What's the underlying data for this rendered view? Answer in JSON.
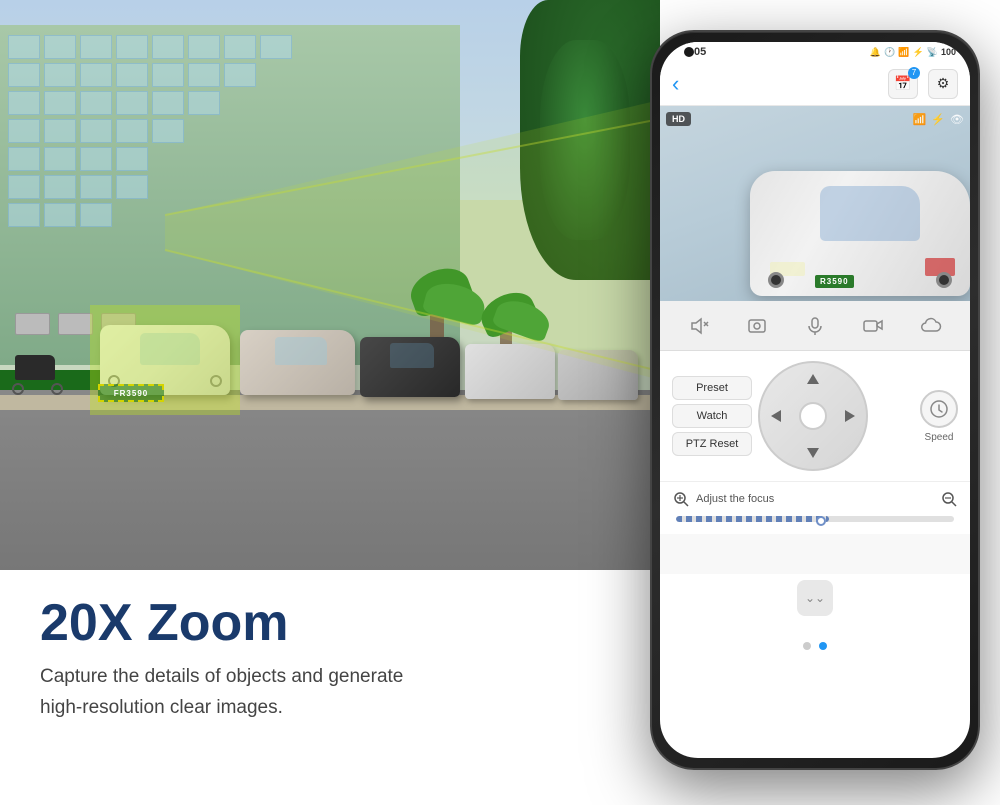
{
  "scene": {
    "background_color": "#c8d8c0"
  },
  "bottom_section": {
    "title": "20X Zoom",
    "description_line1": "Capture the details of objects and generate",
    "description_line2": "high-resolution clear images."
  },
  "phone": {
    "status_bar": {
      "time": "05",
      "icons": [
        "📶",
        "🔋",
        "📡"
      ]
    },
    "header": {
      "back_icon": "‹",
      "calendar_icon": "📅",
      "settings_icon": "⚙",
      "calendar_badge": "7"
    },
    "video": {
      "hd_label": "HD",
      "license_plate": "R3590"
    },
    "controls": {
      "icons": [
        "🔇",
        "📷",
        "🎙",
        "▶",
        "☁"
      ]
    },
    "ptz": {
      "preset_label": "Preset",
      "watch_label": "Watch",
      "ptz_reset_label": "PTZ Reset",
      "speed_label": "Speed"
    },
    "focus": {
      "label": "Adjust the focus"
    },
    "nav_dots": [
      {
        "active": false
      },
      {
        "active": true
      }
    ],
    "scroll_down_label": "⌄⌄"
  },
  "license_plate": {
    "text": "FR3590"
  }
}
